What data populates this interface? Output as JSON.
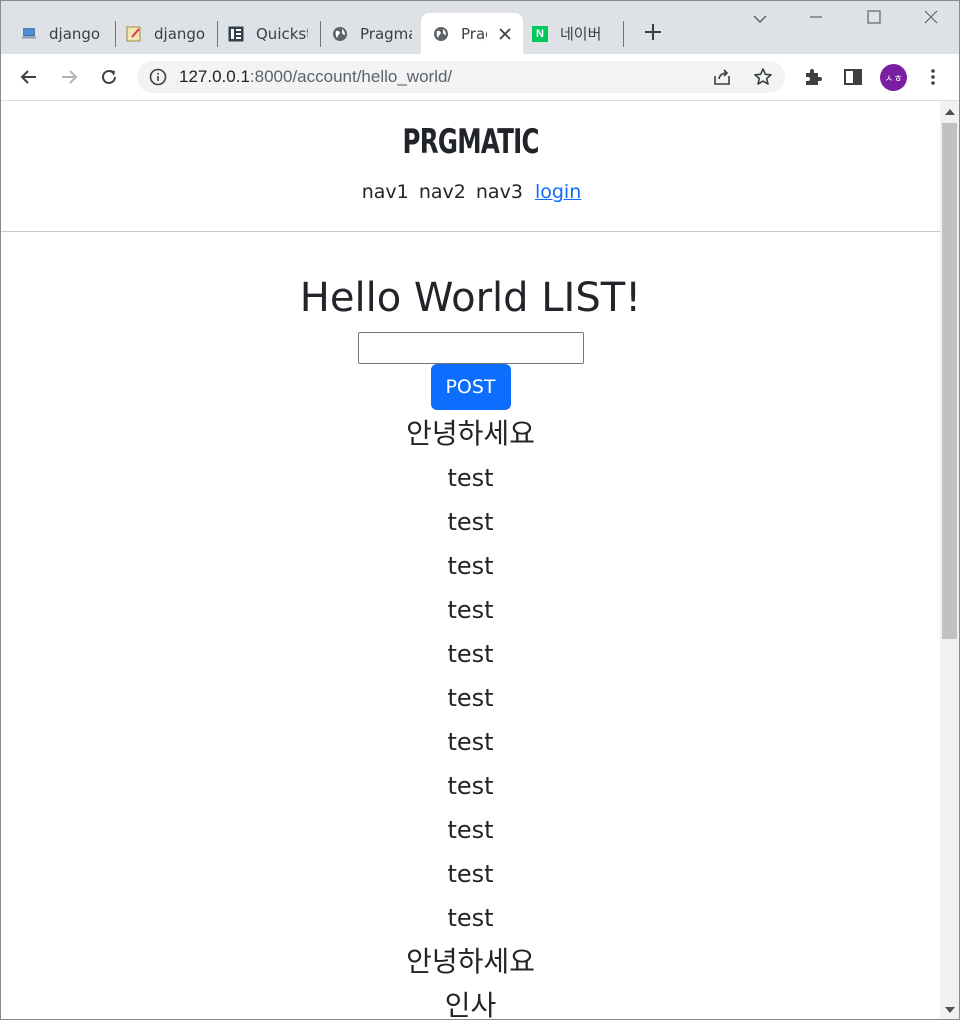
{
  "browser": {
    "tabs": [
      {
        "title": "django",
        "icon": "laptop-icon"
      },
      {
        "title": "django",
        "icon": "notepad-icon"
      },
      {
        "title": "Quickst",
        "icon": "document-panel-icon"
      },
      {
        "title": "Pragma",
        "icon": "globe-icon"
      },
      {
        "title": "Prag",
        "icon": "globe-icon",
        "active": true
      },
      {
        "title": "네이버",
        "icon": "naver-icon"
      }
    ],
    "naver_icon_letter": "N",
    "url_host": "127.0.0.1",
    "url_path": ":8000/account/hello_world/",
    "avatar_initials": "ㅅㅎ",
    "accent_color": "#0d6efd",
    "avatar_color": "#7b1fa2"
  },
  "site": {
    "logo": "PRGMATIC",
    "nav": [
      "nav1",
      "nav2",
      "nav3"
    ],
    "login": "login"
  },
  "main": {
    "title": "Hello World LIST!",
    "input_value": "",
    "post_label": "POST",
    "items": [
      "안녕하세요",
      "test",
      "test",
      "test",
      "test",
      "test",
      "test",
      "test",
      "test",
      "test",
      "test",
      "test",
      "안녕하세요",
      "인사"
    ]
  }
}
